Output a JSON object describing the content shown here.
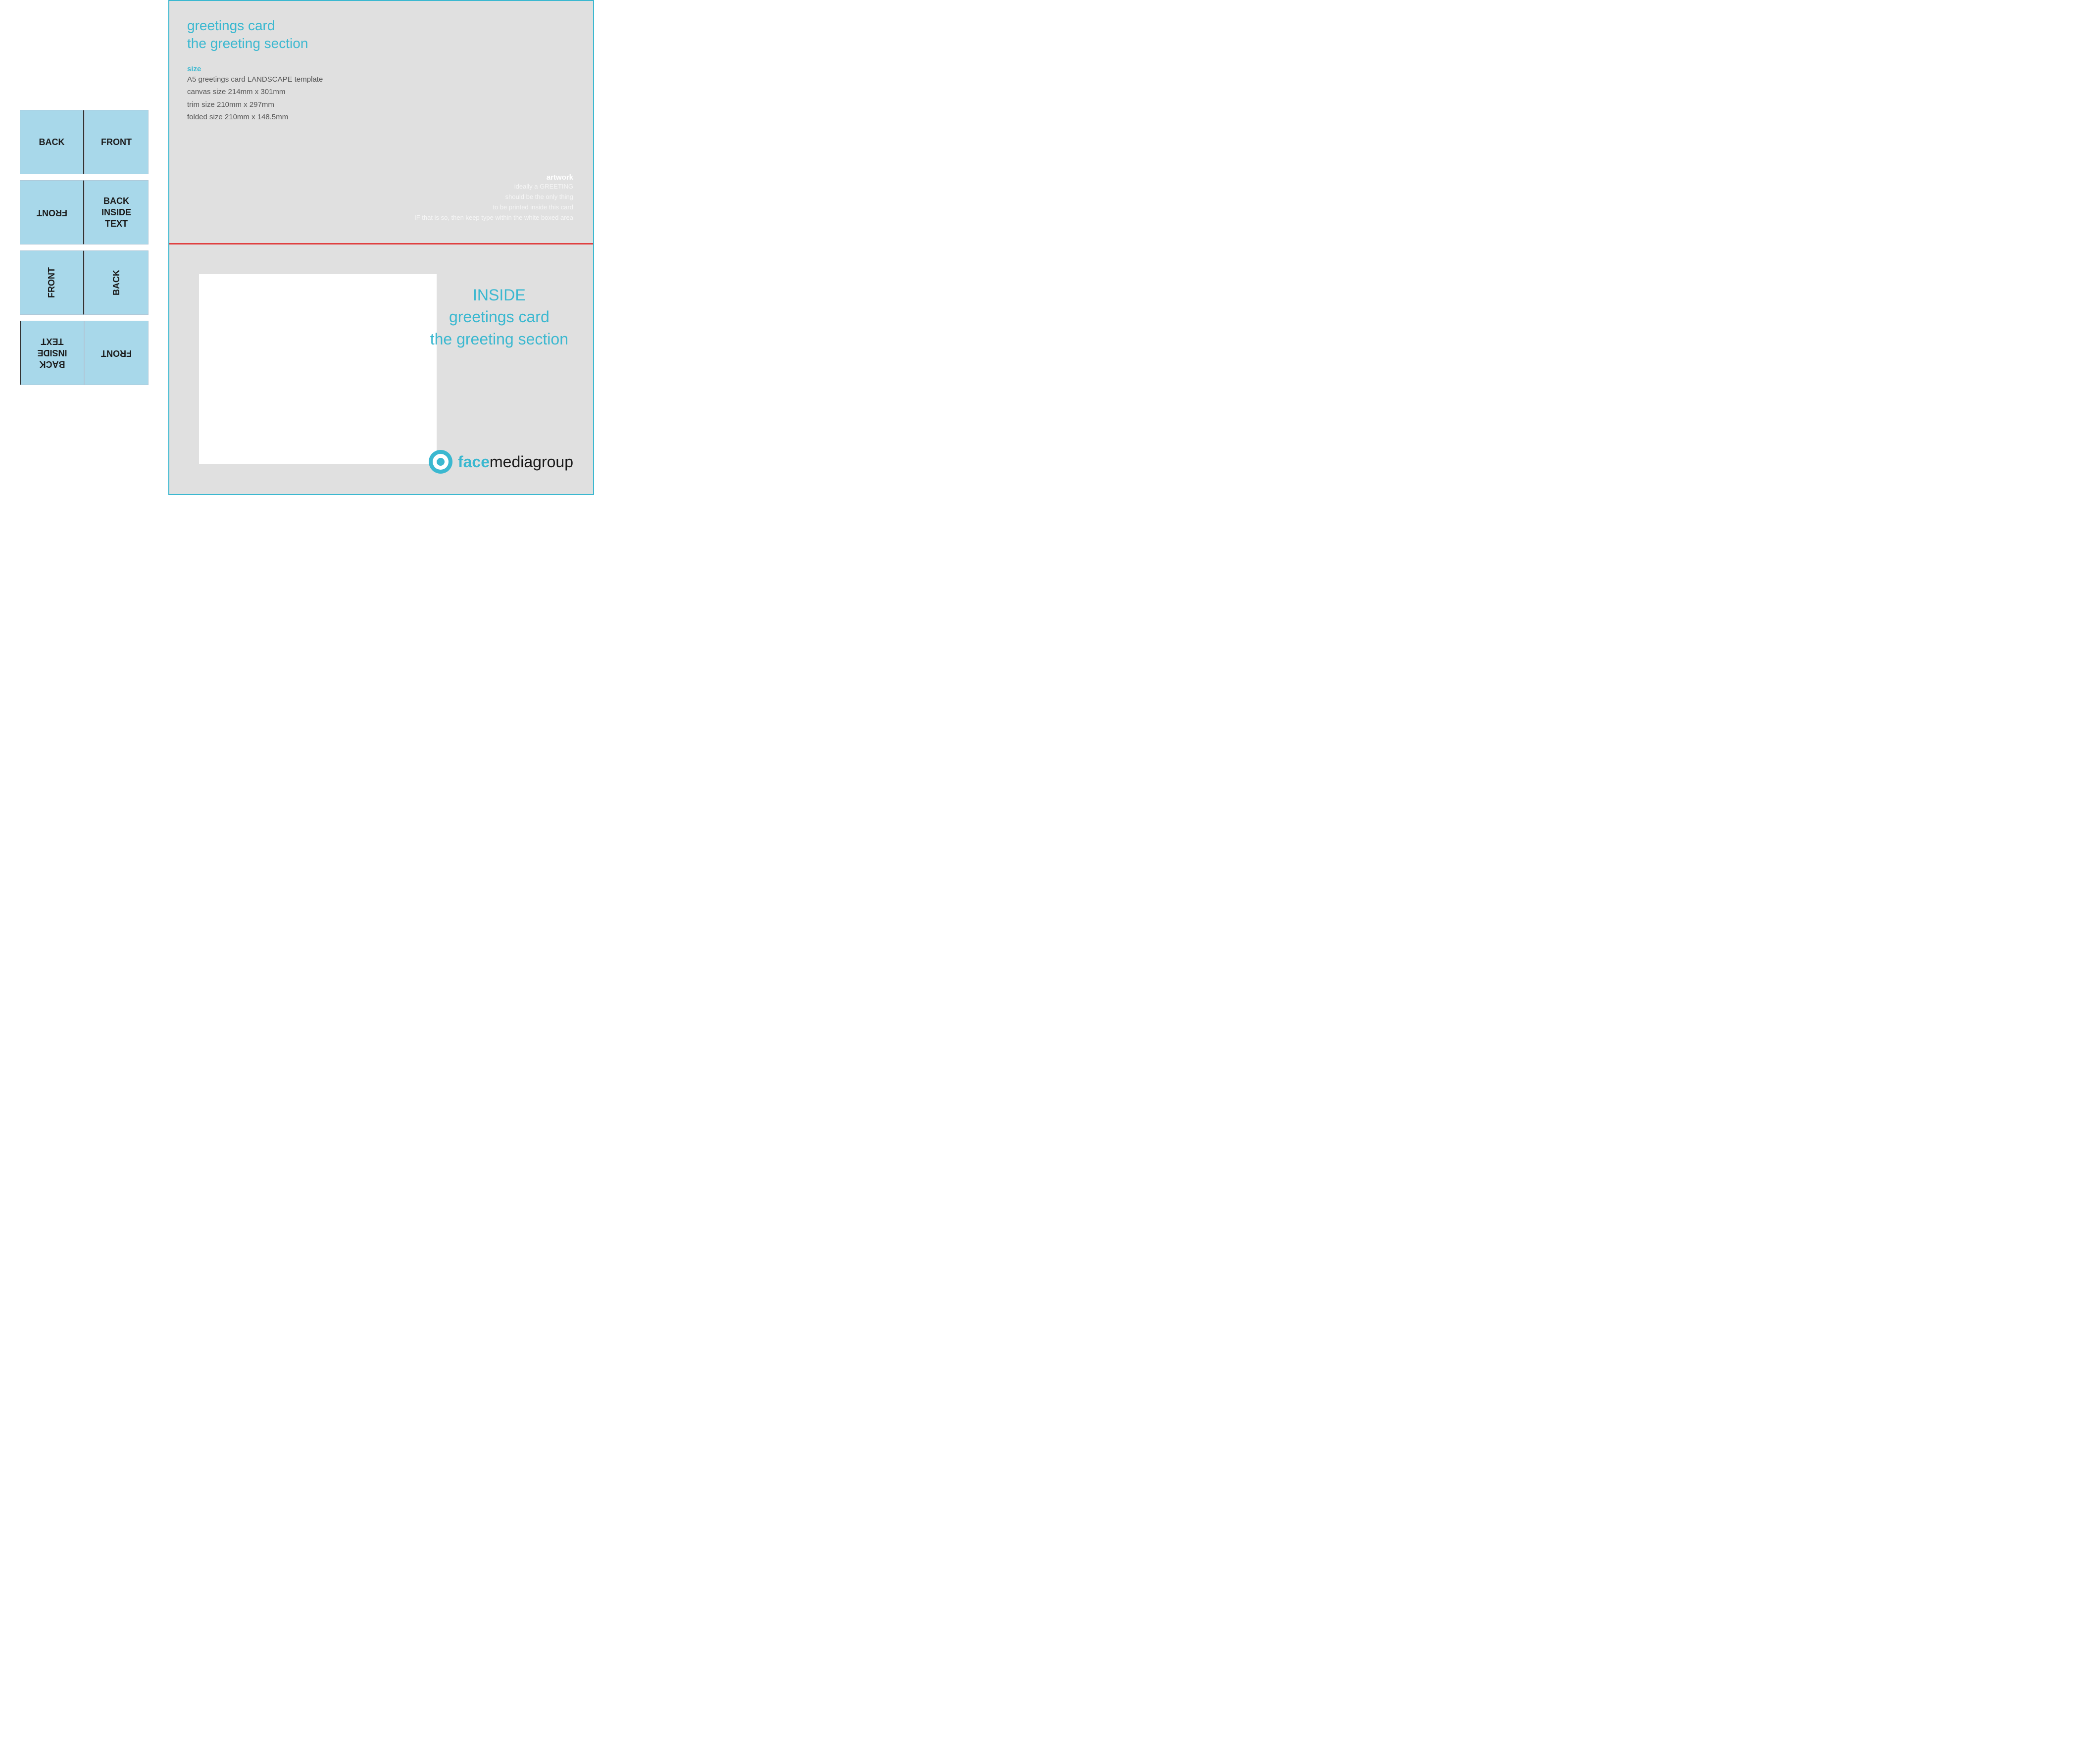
{
  "left": {
    "row1": {
      "cell1": "BACK",
      "cell2": "FRONT"
    },
    "row2": {
      "cell1": "FRONT",
      "cell2_line1": "BACK",
      "cell2_line2": "INSIDE",
      "cell2_line3": "TEXT"
    },
    "row3": {
      "cell1": "FRONT",
      "cell2": "BACK"
    },
    "row4": {
      "cell1_line1": "BACK",
      "cell1_line2": "INSIDE",
      "cell1_line3": "TEXT",
      "cell2": "FRONT"
    }
  },
  "right": {
    "top": {
      "title_line1": "greetings card",
      "title_line2": "the greeting section",
      "size_label": "size",
      "size_line1": "A5 greetings card LANDSCAPE template",
      "size_line2": "canvas size 214mm x 301mm",
      "size_line3": "trim size 210mm x 297mm",
      "size_line4": "folded size 210mm x 148.5mm",
      "artwork_label": "artwork",
      "artwork_line1": "ideally a GREETING",
      "artwork_line2": "should be the only thing",
      "artwork_line3": "to be printed inside this card",
      "artwork_line4": "IF that is so, then keep type within the white boxed area"
    },
    "bottom": {
      "inside_label": "INSIDE",
      "inside_line2": "greetings card",
      "inside_line3": "the greeting section",
      "logo_face": "face",
      "logo_rest": "mediagroup"
    }
  }
}
